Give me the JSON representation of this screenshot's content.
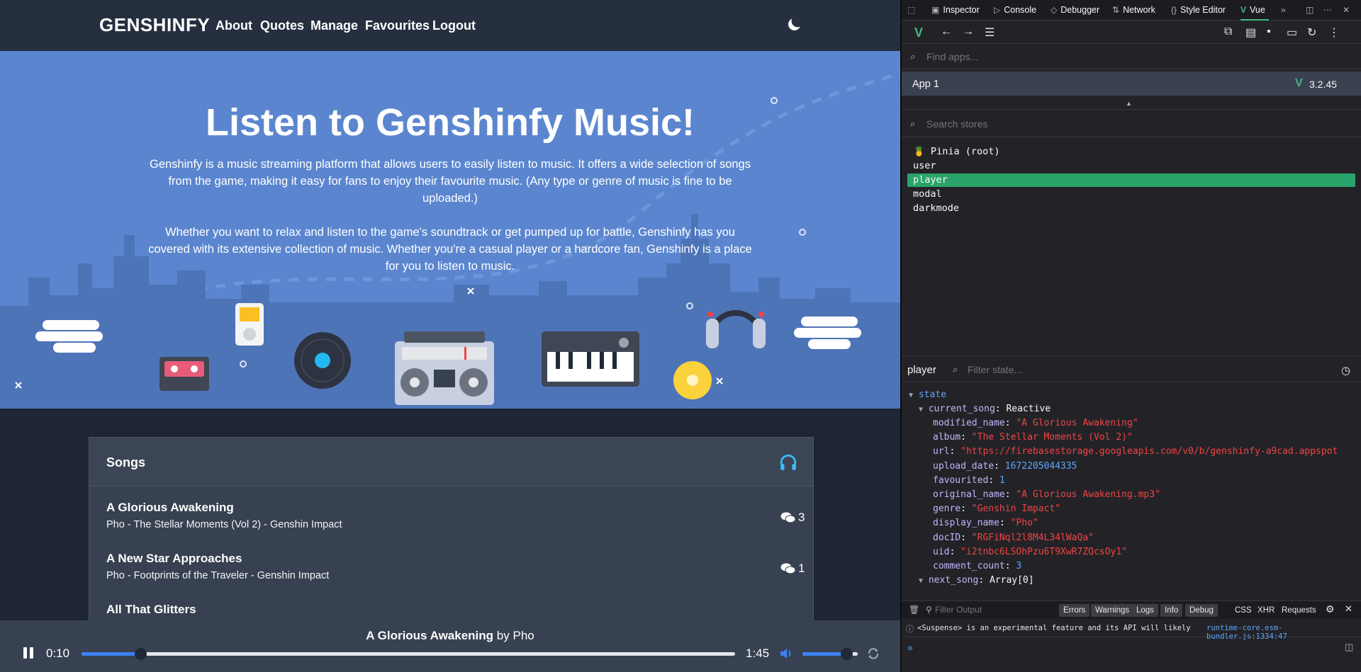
{
  "site": {
    "brand": "GENSHINFY",
    "nav": [
      "About",
      "Quotes",
      "Manage",
      "Favourites",
      "Logout"
    ],
    "hero_title": "Listen to Genshinfy Music!",
    "hero_para1": "Genshinfy is a music streaming platform that allows users to easily listen to music. It offers a wide selection of songs from the game, making it easy for fans to enjoy their favourite music. (Any type or genre of music is fine to be uploaded.)",
    "hero_para2": "Whether you want to relax and listen to the game's soundtrack or get pumped up for battle, Genshinfy has you covered with its extensive collection of music. Whether you're a casual player or a hardcore fan, Genshinfy is a place for you to listen to music.",
    "songs_heading": "Songs",
    "songs": [
      {
        "title": "A Glorious Awakening",
        "meta": "Pho - The Stellar Moments (Vol 2) - Genshin Impact",
        "comments": "3"
      },
      {
        "title": "A New Star Approaches",
        "meta": "Pho - Footprints of the Traveler - Genshin Impact",
        "comments": "1"
      },
      {
        "title": "All That Glitters",
        "meta": "",
        "comments": ""
      }
    ],
    "player": {
      "title": "A Glorious Awakening",
      "by": "by",
      "artist": "Pho",
      "current_time": "0:10",
      "duration": "1:45",
      "progress": 0.09,
      "volume": 0.8
    }
  },
  "colors": {
    "accent": "#3b82f6",
    "hero_bg": "#5b86cf",
    "vue_green": "#42b883",
    "selected_store": "#2aa36b"
  },
  "devtools": {
    "tabs": [
      "Inspector",
      "Console",
      "Debugger",
      "Network",
      "Style Editor",
      "Vue"
    ],
    "find_apps_placeholder": "Find apps...",
    "app_name": "App 1",
    "vue_version": "3.2.45",
    "search_stores_placeholder": "Search stores",
    "stores": [
      "🍍 Pinia (root)",
      "user",
      "player",
      "modal",
      "darkmode"
    ],
    "selected_store": "player",
    "state_store_name": "player",
    "filter_state_placeholder": "Filter state...",
    "state_root": "state",
    "current_song_key": "current_song",
    "current_song_type": "Reactive",
    "fields": [
      {
        "key": "modified_name",
        "value": "\"A Glorious Awakening\"",
        "kind": "s"
      },
      {
        "key": "album",
        "value": "\"The Stellar Moments (Vol 2)\"",
        "kind": "s"
      },
      {
        "key": "url",
        "value": "\"https://firebasestorage.googleapis.com/v0/b/genshinfy-a9cad.appspot",
        "kind": "s"
      },
      {
        "key": "upload_date",
        "value": "1672205044335",
        "kind": "n"
      },
      {
        "key": "favourited",
        "value": "1",
        "kind": "n"
      },
      {
        "key": "original_name",
        "value": "\"A Glorious Awakening.mp3\"",
        "kind": "s"
      },
      {
        "key": "genre",
        "value": "\"Genshin Impact\"",
        "kind": "s"
      },
      {
        "key": "display_name",
        "value": "\"Pho\"",
        "kind": "s"
      },
      {
        "key": "docID",
        "value": "\"RGFiNql2l8M4L34lWaQa\"",
        "kind": "s"
      },
      {
        "key": "uid",
        "value": "\"i2tnbc6LSOhPzu6T9XwR7ZQcsOy1\"",
        "kind": "s"
      },
      {
        "key": "comment_count",
        "value": "3",
        "kind": "n"
      }
    ],
    "next_song_key": "next_song",
    "next_song_type": "Array[0]",
    "console": {
      "filter_placeholder": "Filter Output",
      "filters": [
        "Errors",
        "Warnings",
        "Logs",
        "Info",
        "Debug"
      ],
      "extra": [
        "CSS",
        "XHR",
        "Requests"
      ],
      "message": "<Suspense> is an experimental feature and its API will likely",
      "source": "runtime-core.esm-bundler.js:1334:47"
    }
  }
}
